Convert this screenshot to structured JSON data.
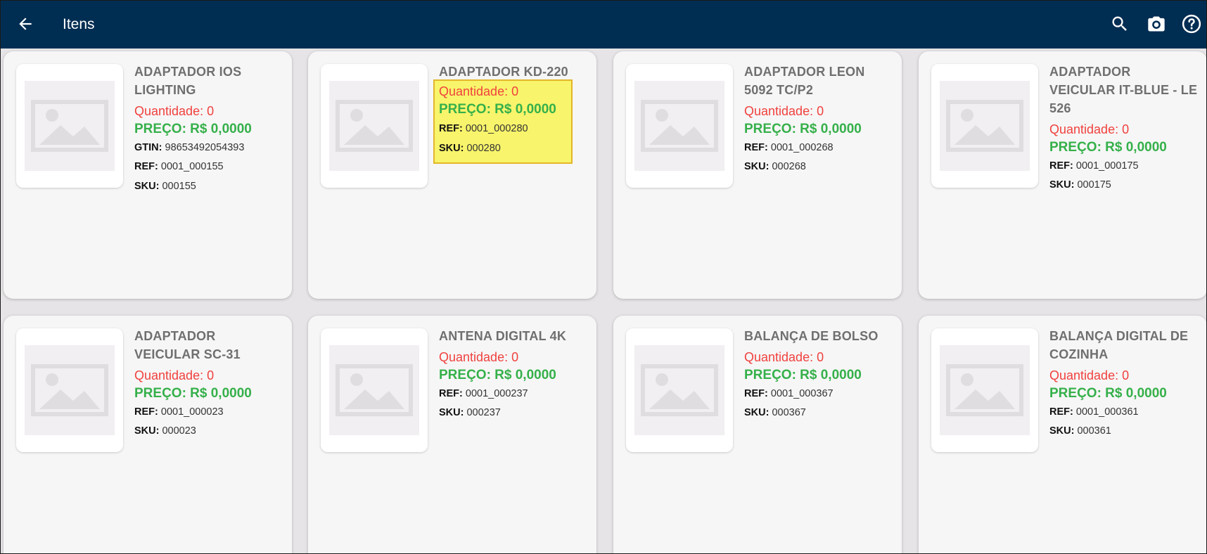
{
  "header": {
    "title": "Itens",
    "back_icon": "arrow-left-icon",
    "actions": [
      "search-icon",
      "camera-icon",
      "help-icon"
    ],
    "background": "#002d52"
  },
  "labels": {
    "qty_prefix": "Quantidade: ",
    "price_prefix": "PREÇO: ",
    "gtin": "GTIN:",
    "ref": "REF:",
    "sku": "SKU:"
  },
  "colors": {
    "quantity": "#f0413e",
    "price": "#35b04a",
    "highlight": "#f8f46b"
  },
  "items": [
    {
      "name": "ADAPTADOR IOS LIGHTING",
      "quantidade": "Quantidade: 0",
      "preco": "PREÇO: R$ 0,0000",
      "gtin": "98653492054393",
      "ref": "0001_000155",
      "sku": "000155"
    },
    {
      "name": "ADAPTADOR KD-220",
      "quantidade": "Quantidade: 0",
      "preco": "PREÇO: R$ 0,0000",
      "ref": "0001_000280",
      "sku": "000280",
      "highlighted": true
    },
    {
      "name": "ADAPTADOR LEON 5092 TC/P2",
      "quantidade": "Quantidade: 0",
      "preco": "PREÇO: R$ 0,0000",
      "ref": "0001_000268",
      "sku": "000268"
    },
    {
      "name": "ADAPTADOR VEICULAR IT-BLUE - LE 526",
      "quantidade": "Quantidade: 0",
      "preco": "PREÇO: R$ 0,0000",
      "ref": "0001_000175",
      "sku": "000175"
    },
    {
      "name": "ADAPTADOR VEICULAR SC-31",
      "quantidade": "Quantidade: 0",
      "preco": "PREÇO: R$ 0,0000",
      "ref": "0001_000023",
      "sku": "000023"
    },
    {
      "name": "ANTENA DIGITAL 4K",
      "quantidade": "Quantidade: 0",
      "preco": "PREÇO: R$ 0,0000",
      "ref": "0001_000237",
      "sku": "000237"
    },
    {
      "name": "BALANÇA DE BOLSO",
      "quantidade": "Quantidade: 0",
      "preco": "PREÇO: R$ 0,0000",
      "ref": "0001_000367",
      "sku": "000367"
    },
    {
      "name": "BALANÇA DIGITAL DE COZINHA",
      "quantidade": "Quantidade: 0",
      "preco": "PREÇO: R$ 0,0000",
      "ref": "0001_000361",
      "sku": "000361"
    }
  ]
}
